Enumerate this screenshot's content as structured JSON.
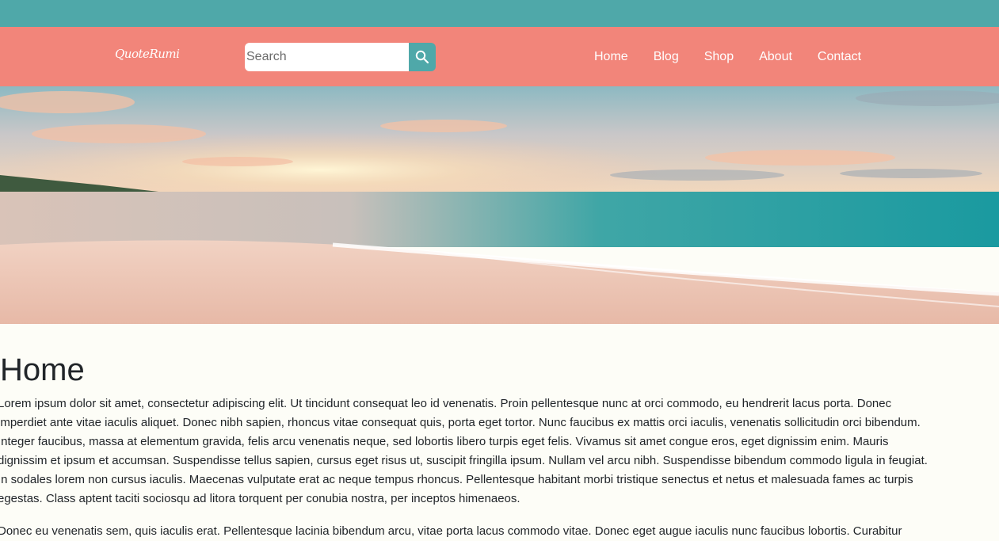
{
  "header": {
    "logo": "QuoteRumi",
    "search": {
      "placeholder": "Search",
      "value": ""
    },
    "search_icon": "search-icon",
    "nav": [
      "Home",
      "Blog",
      "Shop",
      "About",
      "Contact"
    ]
  },
  "colors": {
    "topbar": "#4fa8a9",
    "navbar": "#f2857a",
    "search_button": "#4fa8a9",
    "background": "#fdfdf7"
  },
  "hero": {
    "description_icon": "beach-sunset-image"
  },
  "main": {
    "title": "Home",
    "paragraphs": [
      "Lorem ipsum dolor sit amet, consectetur adipiscing elit. Ut tincidunt consequat leo id venenatis. Proin pellentesque nunc at orci commodo, eu hendrerit lacus porta. Donec\nimperdiet ante vitae iaculis aliquet. Donec nibh sapien, rhoncus vitae consequat quis, porta eget tortor. Nunc faucibus ex mattis orci iaculis, venenatis sollicitudin orci bibendum.\nInteger faucibus, massa at elementum gravida, felis arcu venenatis neque, sed lobortis libero turpis eget felis. Vivamus sit amet congue eros, eget dignissim enim. Mauris\ndignissim et ipsum et accumsan. Suspendisse tellus sapien, cursus eget risus ut, suscipit fringilla ipsum. Nullam vel arcu nibh. Suspendisse bibendum commodo ligula in feugiat.\nIn sodales lorem non cursus iaculis. Maecenas vulputate erat ac neque tempus rhoncus. Pellentesque habitant morbi tristique senectus et netus et malesuada fames ac turpis\negestas. Class aptent taciti sociosqu ad litora torquent per conubia nostra, per inceptos himenaeos.",
      "Donec eu venenatis sem, quis iaculis erat. Pellentesque lacinia bibendum arcu, vitae porta lacus commodo vitae. Donec eget augue iaculis nunc faucibus lobortis. Curabitur"
    ]
  }
}
